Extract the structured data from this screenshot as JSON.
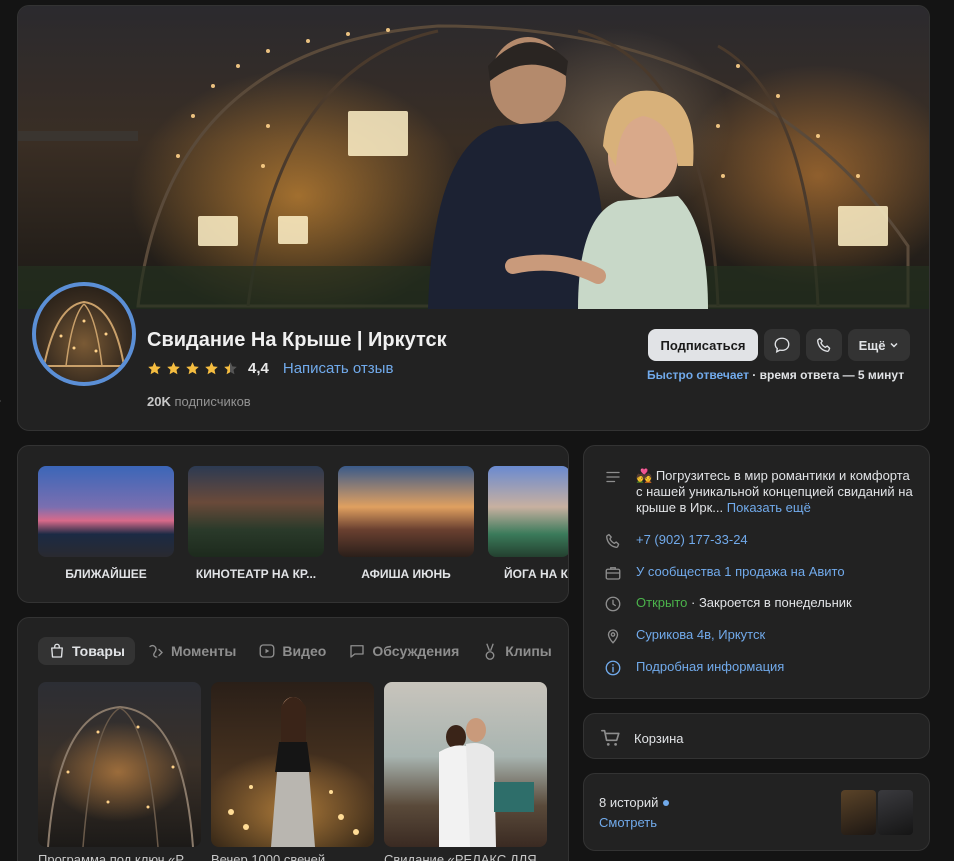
{
  "community": {
    "title": "Свидание На Крыше | Иркутск",
    "rating_value": "4,4",
    "rating_stars": 4.4,
    "review_link": "Написать отзыв",
    "subscribers_count": "20K",
    "subscribers_label": "подписчиков"
  },
  "actions": {
    "subscribe_label": "Подписаться",
    "more_label": "Ещё",
    "reply_fast": "Быстро отвечает",
    "reply_time": "· время ответа — 5 минут"
  },
  "highlights": [
    {
      "label": "БЛИЖАЙШЕЕ"
    },
    {
      "label": "КИНОТЕАТР НА КР..."
    },
    {
      "label": "АФИША ИЮНЬ"
    },
    {
      "label": "ЙОГА НА К"
    }
  ],
  "tabs": [
    {
      "label": "Товары",
      "icon": "shopping-bag-icon",
      "active": true
    },
    {
      "label": "Моменты",
      "icon": "moments-icon",
      "active": false
    },
    {
      "label": "Видео",
      "icon": "video-icon",
      "active": false
    },
    {
      "label": "Обсуждения",
      "icon": "discussions-icon",
      "active": false
    },
    {
      "label": "Клипы",
      "icon": "clips-icon",
      "active": false
    }
  ],
  "products": [
    {
      "title": "Программа под ключ «Р"
    },
    {
      "title": "Вечер 1000 свечей"
    },
    {
      "title": "Свидание «РЕЛАКС ДЛЯ"
    }
  ],
  "info": {
    "description_emoji": "💑",
    "description": "Погрузитесь в мир романтики и комфорта с нашей уникальной концепцией свиданий на крыше в Ирк...",
    "show_more": "Показать ещё",
    "phone": "+7 (902) 177-33-24",
    "avito": "У сообщества 1 продажа на Авито",
    "status_open": "Открыто",
    "status_close": "· Закроется в понедельник",
    "address": "Сурикова 4в, Иркутск",
    "details": "Подробная информация"
  },
  "cart": {
    "label": "Корзина"
  },
  "stories": {
    "count_label": "8 историй",
    "link": "Смотреть"
  },
  "colors": {
    "accent": "#71aaeb",
    "open": "#4bb34b",
    "avatar_ring": "#5b8fd6"
  }
}
